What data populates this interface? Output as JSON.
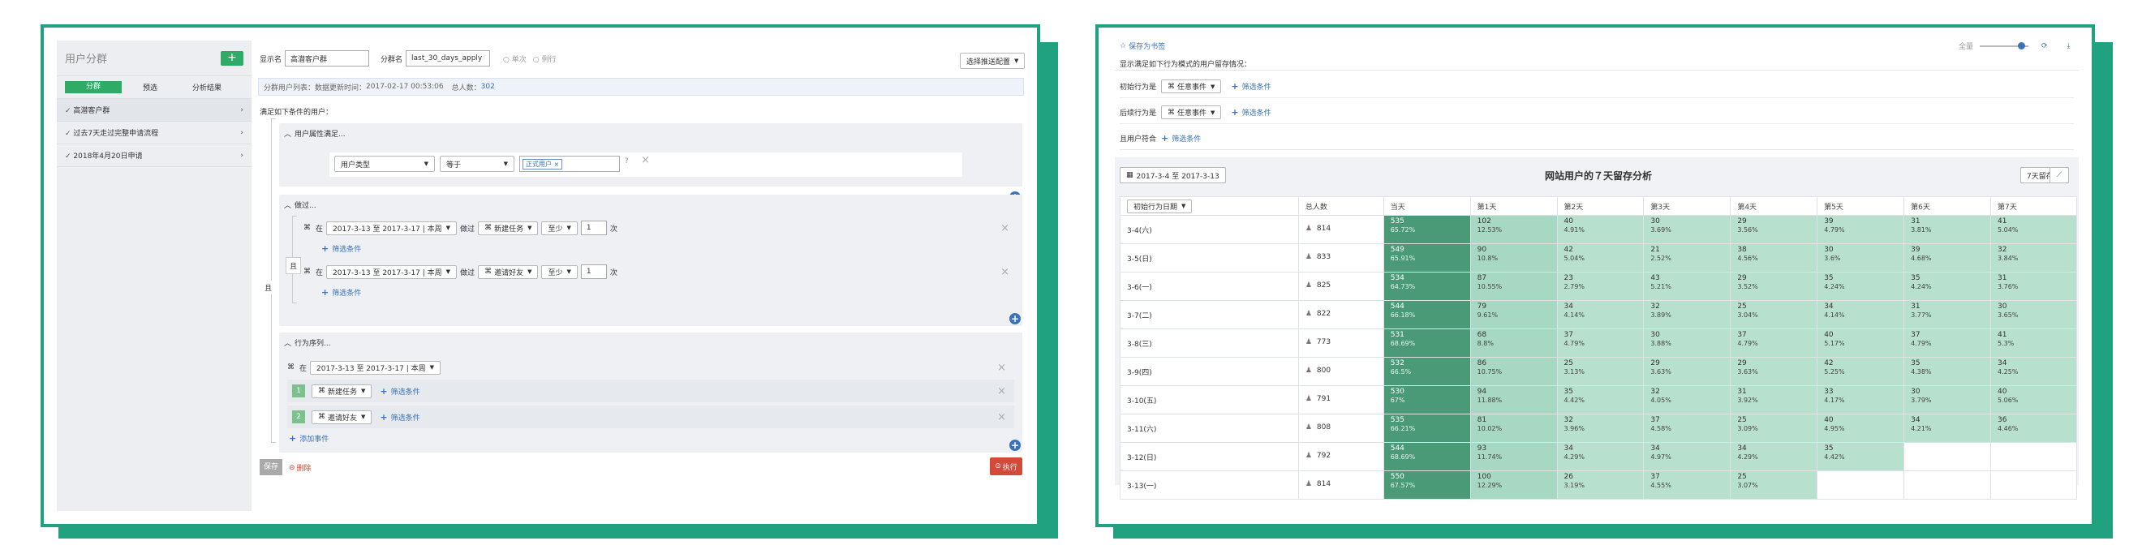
{
  "left": {
    "sidebar": {
      "title": "用户分群",
      "add_label": "+",
      "tabs": [
        "分群",
        "预选",
        "分析结果"
      ],
      "items": [
        "高潜客户群",
        "过去7天走过完整申请流程",
        "2018年4月20日申请"
      ]
    },
    "header": {
      "display_name_label": "显示名",
      "display_name_value": "高潜客户群",
      "group_name_label": "分群名",
      "group_name_value": "last_30_days_apply",
      "radio_once": "单次",
      "radio_routine": "例行",
      "push_button": "选择推送配置"
    },
    "info": {
      "text1": "分群用户列表：数据更新时间：",
      "update_time": "2017-02-17 00:53:06",
      "total_label": "总人数：",
      "total_value": "302"
    },
    "condition_title": "满足如下条件的用户：",
    "and_label": "且",
    "prop": {
      "title": "用户属性满足...",
      "field": "用户类型",
      "op": "等于",
      "tag": "正式用户"
    },
    "did": {
      "title": "做过...",
      "and_label": "且",
      "rows": [
        {
          "in": "在",
          "date": "2017-3-13 至 2017-3-17 | 本周",
          "did": "做过",
          "event": "新建任务",
          "cmp": "至少",
          "num": "1",
          "unit": "次",
          "filter": "筛选条件"
        },
        {
          "in": "在",
          "date": "2017-3-13 至 2017-3-17 | 本周",
          "did": "做过",
          "event": "邀请好友",
          "cmp": "至少",
          "num": "1",
          "unit": "次",
          "filter": "筛选条件"
        }
      ]
    },
    "seq": {
      "title": "行为序列...",
      "in": "在",
      "date": "2017-3-13 至 2017-3-17 | 本周",
      "steps": [
        {
          "n": "1",
          "event": "新建任务",
          "filter": "筛选条件"
        },
        {
          "n": "2",
          "event": "邀请好友",
          "filter": "筛选条件"
        }
      ],
      "add_event": "添加事件"
    },
    "footer": {
      "save": "保存",
      "delete": "删除",
      "run": "执行"
    }
  },
  "right": {
    "bookmark": "保存为书签",
    "zoom_label": "全量",
    "zoom_level": 0.85,
    "desc": "显示满足如下行为模式的用户留存情况：",
    "initial_label": "初始行为是",
    "initial_value": "任意事件",
    "return_label": "后续行为是",
    "return_value": "任意事件",
    "group_label": "且用户符合",
    "filter": "筛选条件",
    "date_range": "2017-3-4 至 2017-3-13",
    "title": "网站用户的７天留存分析",
    "period": "7天留存",
    "col_date": "初始行为日期",
    "col_total": "总人数",
    "days": [
      "当天",
      "第1天",
      "第2天",
      "第3天",
      "第4天",
      "第5天",
      "第6天",
      "第7天"
    ],
    "rows": [
      {
        "date": "3-4(六)",
        "total": "814",
        "cells": [
          [
            "535",
            "65.72%"
          ],
          [
            "102",
            "12.53%"
          ],
          [
            "40",
            "4.91%"
          ],
          [
            "30",
            "3.69%"
          ],
          [
            "29",
            "3.56%"
          ],
          [
            "39",
            "4.79%"
          ],
          [
            "31",
            "3.81%"
          ],
          [
            "41",
            "5.04%"
          ]
        ]
      },
      {
        "date": "3-5(日)",
        "total": "833",
        "cells": [
          [
            "549",
            "65.91%"
          ],
          [
            "90",
            "10.8%"
          ],
          [
            "42",
            "5.04%"
          ],
          [
            "21",
            "2.52%"
          ],
          [
            "38",
            "4.56%"
          ],
          [
            "30",
            "3.6%"
          ],
          [
            "39",
            "4.68%"
          ],
          [
            "32",
            "3.84%"
          ]
        ]
      },
      {
        "date": "3-6(一)",
        "total": "825",
        "cells": [
          [
            "534",
            "64.73%"
          ],
          [
            "87",
            "10.55%"
          ],
          [
            "23",
            "2.79%"
          ],
          [
            "43",
            "5.21%"
          ],
          [
            "29",
            "3.52%"
          ],
          [
            "35",
            "4.24%"
          ],
          [
            "35",
            "4.24%"
          ],
          [
            "31",
            "3.76%"
          ]
        ]
      },
      {
        "date": "3-7(二)",
        "total": "822",
        "cells": [
          [
            "544",
            "66.18%"
          ],
          [
            "79",
            "9.61%"
          ],
          [
            "34",
            "4.14%"
          ],
          [
            "32",
            "3.89%"
          ],
          [
            "25",
            "3.04%"
          ],
          [
            "34",
            "4.14%"
          ],
          [
            "31",
            "3.77%"
          ],
          [
            "30",
            "3.65%"
          ]
        ]
      },
      {
        "date": "3-8(三)",
        "total": "773",
        "cells": [
          [
            "531",
            "68.69%"
          ],
          [
            "68",
            "8.8%"
          ],
          [
            "37",
            "4.79%"
          ],
          [
            "30",
            "3.88%"
          ],
          [
            "37",
            "4.79%"
          ],
          [
            "40",
            "5.17%"
          ],
          [
            "37",
            "4.79%"
          ],
          [
            "41",
            "5.3%"
          ]
        ]
      },
      {
        "date": "3-9(四)",
        "total": "800",
        "cells": [
          [
            "532",
            "66.5%"
          ],
          [
            "86",
            "10.75%"
          ],
          [
            "25",
            "3.13%"
          ],
          [
            "29",
            "3.63%"
          ],
          [
            "29",
            "3.63%"
          ],
          [
            "42",
            "5.25%"
          ],
          [
            "35",
            "4.38%"
          ],
          [
            "34",
            "4.25%"
          ]
        ]
      },
      {
        "date": "3-10(五)",
        "total": "791",
        "cells": [
          [
            "530",
            "67%"
          ],
          [
            "94",
            "11.88%"
          ],
          [
            "35",
            "4.42%"
          ],
          [
            "32",
            "4.05%"
          ],
          [
            "31",
            "3.92%"
          ],
          [
            "33",
            "4.17%"
          ],
          [
            "30",
            "3.79%"
          ],
          [
            "40",
            "5.06%"
          ]
        ]
      },
      {
        "date": "3-11(六)",
        "total": "808",
        "cells": [
          [
            "535",
            "66.21%"
          ],
          [
            "81",
            "10.02%"
          ],
          [
            "32",
            "3.96%"
          ],
          [
            "37",
            "4.58%"
          ],
          [
            "25",
            "3.09%"
          ],
          [
            "40",
            "4.95%"
          ],
          [
            "34",
            "4.21%"
          ],
          [
            "36",
            "4.46%"
          ]
        ]
      },
      {
        "date": "3-12(日)",
        "total": "792",
        "cells": [
          [
            "544",
            "68.69%"
          ],
          [
            "93",
            "11.74%"
          ],
          [
            "34",
            "4.29%"
          ],
          [
            "34",
            "4.97%"
          ],
          [
            "34",
            "4.29%"
          ],
          [
            "35",
            "4.42%"
          ]
        ]
      },
      {
        "date": "3-13(一)",
        "total": "814",
        "cells": [
          [
            "550",
            "67.57%"
          ],
          [
            "100",
            "12.29%"
          ],
          [
            "26",
            "3.19%"
          ],
          [
            "37",
            "4.55%"
          ],
          [
            "25",
            "3.07%"
          ]
        ]
      }
    ]
  }
}
